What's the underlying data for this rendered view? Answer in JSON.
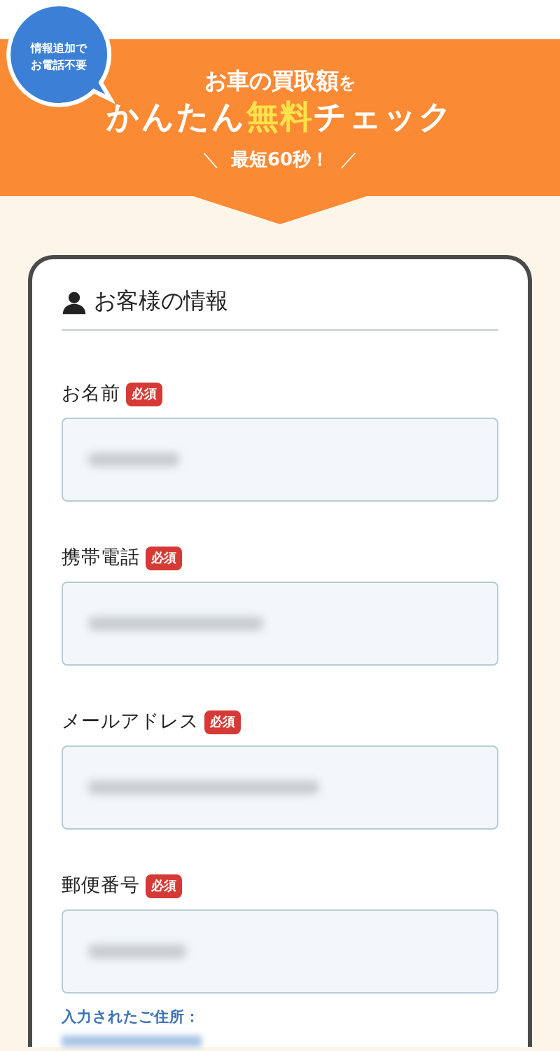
{
  "banner": {
    "bubble": [
      "情報追加で",
      "お電話不要"
    ],
    "headline": [
      [
        {
          "text": "お車の買取額",
          "kind": "normal"
        },
        {
          "text": "を",
          "kind": "small"
        }
      ],
      [
        {
          "text": "かんたん",
          "kind": "normal"
        },
        {
          "text": "無料",
          "kind": "highlight"
        },
        {
          "text": "チェック",
          "kind": "normal"
        }
      ]
    ],
    "tagline": {
      "left": "＼",
      "text": "最短60秒！",
      "right": "／"
    }
  },
  "form": {
    "title": "お客様の情報",
    "fields": [
      {
        "label": "お名前",
        "required": true,
        "badge": "必須"
      },
      {
        "label": "携帯電話",
        "required": true,
        "badge": "必須"
      },
      {
        "label": "メールアドレス",
        "required": true,
        "badge": "必須"
      },
      {
        "label": "郵便番号",
        "required": true,
        "badge": "必須"
      }
    ],
    "address_label": "入力されたご住所："
  }
}
